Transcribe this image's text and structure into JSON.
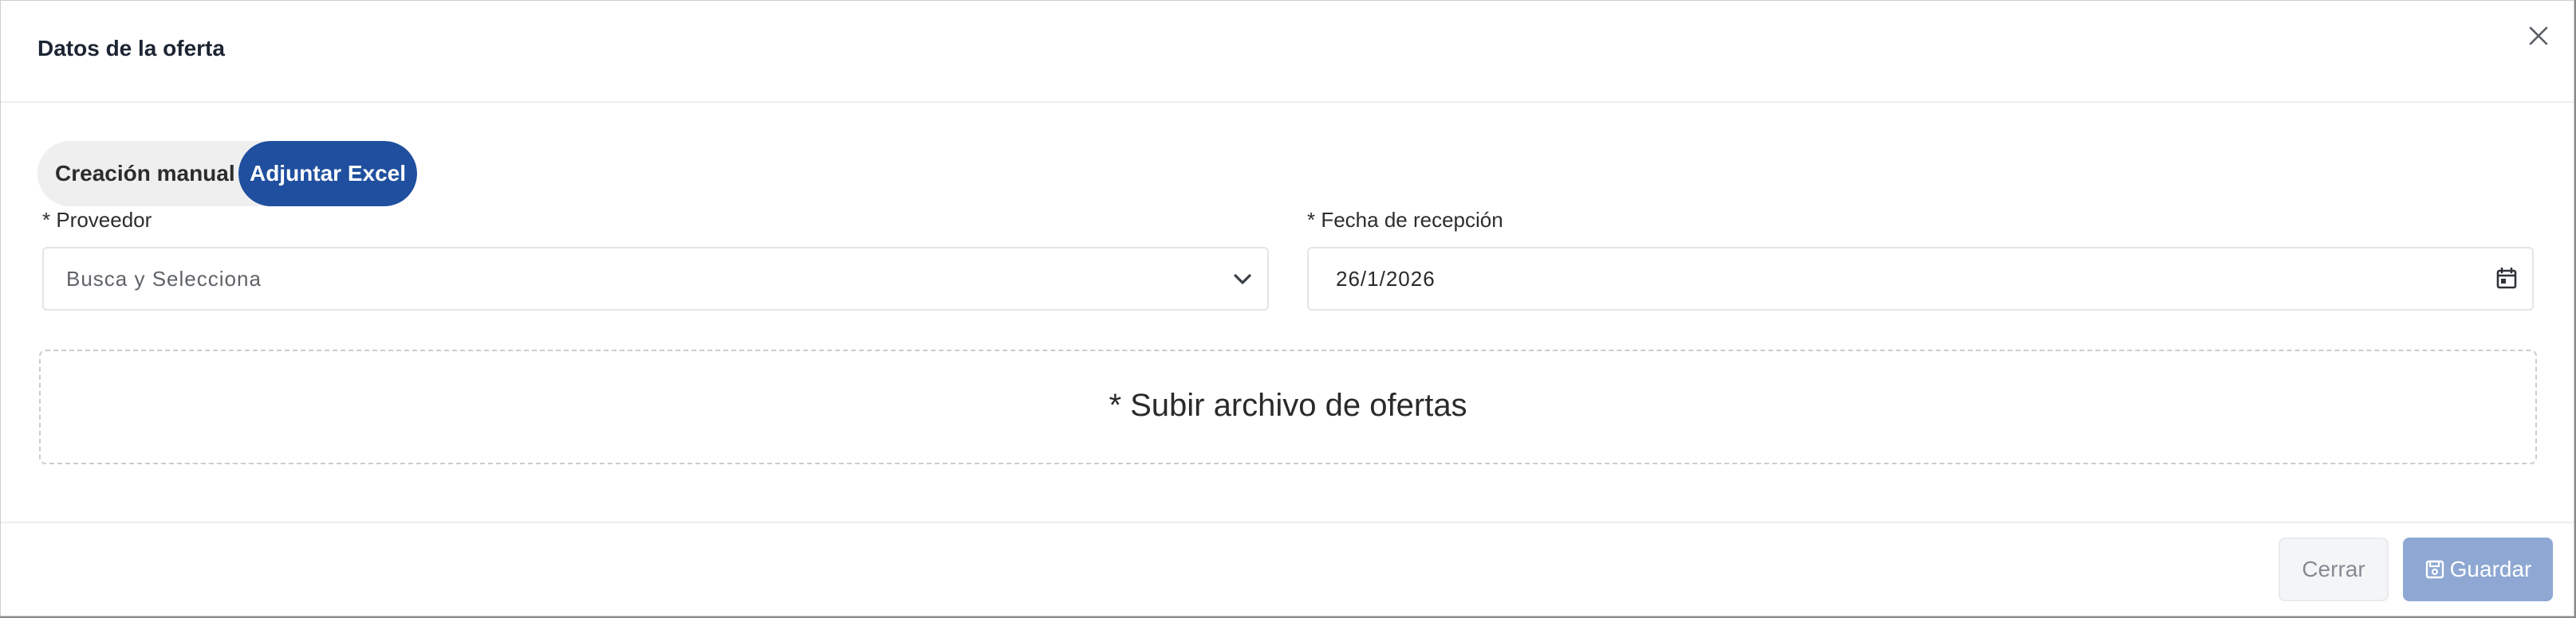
{
  "modal": {
    "title": "Datos de la oferta"
  },
  "mode_toggle": {
    "manual_label": "Creación manual",
    "excel_label": "Adjuntar Excel",
    "selected": "Adjuntar Excel"
  },
  "provider": {
    "label": "* Proveedor",
    "placeholder": "Busca y Selecciona"
  },
  "reception_date": {
    "label": "* Fecha de recepción",
    "value": "26/1/2026"
  },
  "upload": {
    "label": "* Subir archivo de ofertas"
  },
  "footer": {
    "close_label": "Cerrar",
    "save_label": "Guardar"
  },
  "icons": {
    "close": "close-icon",
    "dropdown": "chevron-down-icon",
    "calendar": "calendar-icon",
    "save": "save-icon"
  },
  "colors": {
    "primary": "#1f4f9e",
    "save_disabled": "#8ea8d3",
    "title": "#1d2433"
  }
}
